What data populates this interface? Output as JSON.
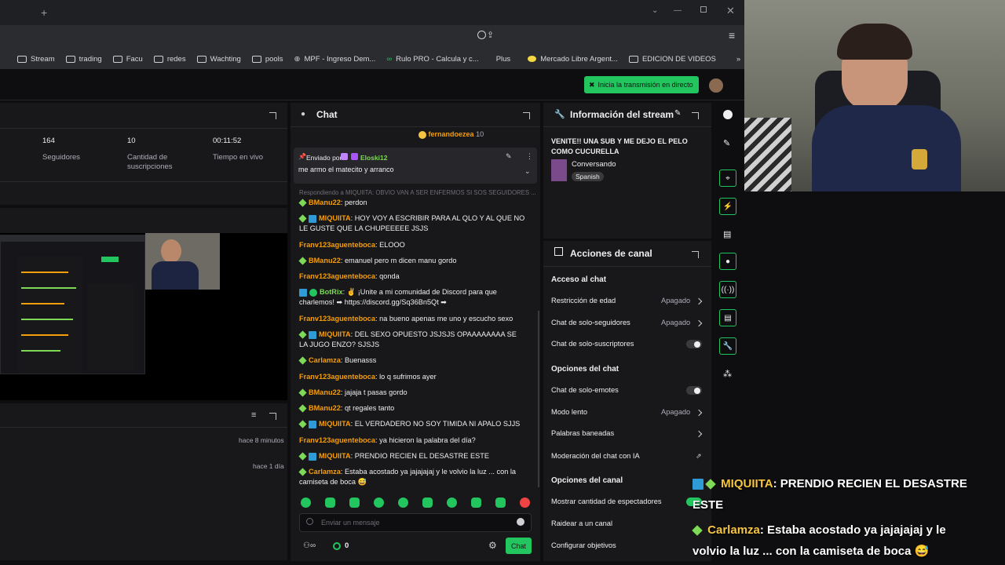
{
  "bookmarks": [
    "Stream",
    "trading",
    "Facu",
    "redes",
    "Wachting",
    "pools",
    "MPF - Ingreso Dem...",
    "Rulo PRO - Calcula y c...",
    "Plus",
    "Mercado Libre Argent...",
    "EDICION DE VIDEOS"
  ],
  "header": {
    "go_live_label": "Inicia la transmisión en directo"
  },
  "stats": [
    {
      "value": "164",
      "label": "Seguidores"
    },
    {
      "value": "10",
      "label": "Cantidad de suscripciones"
    },
    {
      "value": "00:11:52",
      "label": "Tiempo en vivo"
    }
  ],
  "activity": [
    {
      "time": "hace 8 minutos"
    },
    {
      "time": "hace 1 día"
    }
  ],
  "chat": {
    "title": "Chat",
    "top_user": "fernandoezea",
    "top_user_count": "10",
    "pinned_prefix": "Enviado por",
    "pinned_user": "Eloski12",
    "pinned_text": "me armo el matecito y arranco",
    "replying_to": "Respondiendo a MIQUIITA: OBVIO VAN A SER ENFERMOS SI SOS SEGUIDORES ...",
    "messages": [
      {
        "user": "BManu22",
        "text": ": perdon",
        "color": "#f59e0b",
        "badges": "gem"
      },
      {
        "user": "MIQUIITA",
        "text": ": HOY VOY A ESCRIBIR PARA AL QLO Y AL QUE NO LE GUSTE QUE LA CHUPEEEEE JSJS",
        "color": "#f59e0b",
        "badges": "gem-b"
      },
      {
        "user": "Franv123aguenteboca",
        "text": ": ELOOO",
        "color": "#f59e0b",
        "badges": ""
      },
      {
        "user": "BManu22",
        "text": ": emanuel pero m dicen manu gordo",
        "color": "#f59e0b",
        "badges": "gem"
      },
      {
        "user": "Franv123aguenteboca",
        "text": ": qonda",
        "color": "#f59e0b",
        "badges": ""
      },
      {
        "user": "BotRix",
        "text": ": ✌ ¡Unite a mi comunidad de Discord para que charlemos! ➡ https://discord.gg/Sq36Bn5Qt ➡",
        "color": "#7ed957",
        "badges": "b-bot"
      },
      {
        "user": "Franv123aguenteboca",
        "text": ": na bueno apenas me uno y escucho sexo",
        "color": "#f59e0b",
        "badges": ""
      },
      {
        "user": "MIQUIITA",
        "text": ": DEL SEXO OPUESTO JSJSJS OPAAAAAAAA SE LA JUGO ENZO? SJSJS",
        "color": "#f59e0b",
        "badges": "gem-b"
      },
      {
        "user": "Carlamza",
        "text": ": Buenasss",
        "color": "#f59e0b",
        "badges": "gem"
      },
      {
        "user": "Franv123aguenteboca",
        "text": ": lo q sufrimos ayer",
        "color": "#f59e0b",
        "badges": ""
      },
      {
        "user": "BManu22",
        "text": ": jajaja t pasas gordo",
        "color": "#f59e0b",
        "badges": "gem"
      },
      {
        "user": "BManu22",
        "text": ": qt regales tanto",
        "color": "#f59e0b",
        "badges": "gem"
      },
      {
        "user": "MIQUIITA",
        "text": ": EL VERDADERO NO SOY TIMIDA NI APALO SJJS",
        "color": "#f59e0b",
        "badges": "gem-b"
      },
      {
        "user": "Franv123aguenteboca",
        "text": ": ya hicieron la palabra del día?",
        "color": "#f59e0b",
        "badges": ""
      },
      {
        "user": "MIQUIITA",
        "text": ": PRENDIO RECIEN EL DESASTRE ESTE",
        "color": "#f59e0b",
        "badges": "gem-b"
      },
      {
        "user": "Carlamza",
        "text": ": Estaba acostado ya jajajajaj y le volvio la luz ... con la camiseta de boca 😅",
        "color": "#f59e0b",
        "badges": "gem"
      }
    ],
    "input_placeholder": "Enviar un mensaje",
    "points": "0",
    "send_label": "Chat"
  },
  "stream_info": {
    "title": "Información del stream",
    "stream_title": "VENITE!! UNA SUB Y ME DEJO EL PELO COMO CUCURELLA",
    "category": "Conversando",
    "language": "Spanish"
  },
  "channel_actions": {
    "title": "Acciones de canal",
    "sections": [
      {
        "heading": "Acceso al chat"
      },
      {
        "heading": "Opciones del chat"
      },
      {
        "heading": "Opciones del canal"
      }
    ],
    "rows": [
      {
        "label": "Restricción de edad",
        "value": "Apagado"
      },
      {
        "label": "Chat de solo-seguidores",
        "value": "Apagado"
      },
      {
        "label": "Chat de solo-suscriptores",
        "value": ""
      },
      {
        "label": "Chat de solo-emotes",
        "value": ""
      },
      {
        "label": "Modo lento",
        "value": "Apagado"
      },
      {
        "label": "Palabras baneadas",
        "value": ""
      },
      {
        "label": "Moderación del chat con IA",
        "value": ""
      },
      {
        "label": "Mostrar cantidad de espectadores",
        "value": ""
      },
      {
        "label": "Raidear a un canal",
        "value": ""
      },
      {
        "label": "Configurar objetivos",
        "value": ""
      }
    ]
  },
  "overlay": {
    "line1_user": "MIQUIITA",
    "line1_text": ": PRENDIO RECIEN EL DESASTRE",
    "line1_cont": "ESTE",
    "line2_user": "Carlamza",
    "line2_text": ": Estaba acostado ya jajajajaj y le",
    "line2_cont": "volvio la luz ... con la camiseta de boca 😅"
  },
  "colors": {
    "accent": "#22c55e",
    "username": "#f59e0b",
    "bg": "#0e0e10",
    "panel": "#18181b"
  }
}
